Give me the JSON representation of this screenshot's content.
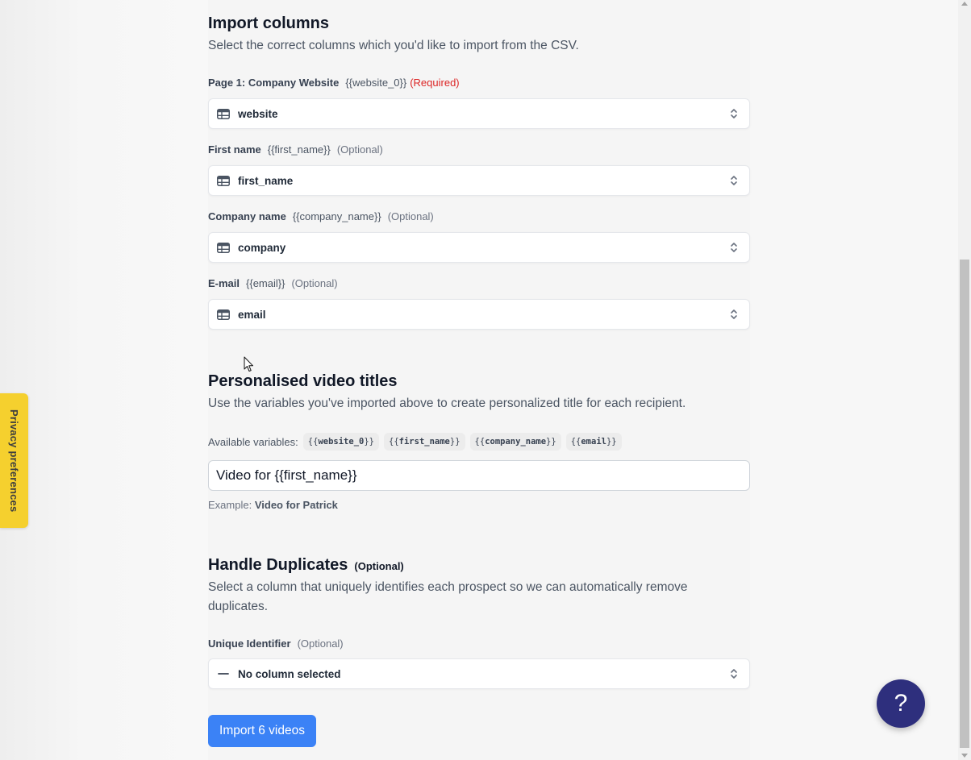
{
  "import_columns": {
    "title": "Import columns",
    "description": "Select the correct columns which you'd like to import from the CSV.",
    "fields": [
      {
        "name": "Page 1: Company Website",
        "variable": "{{website_0}}",
        "tag": "(Required)",
        "required": true,
        "value": "website"
      },
      {
        "name": "First name",
        "variable": "{{first_name}}",
        "tag": "(Optional)",
        "required": false,
        "value": "first_name"
      },
      {
        "name": "Company name",
        "variable": "{{company_name}}",
        "tag": "(Optional)",
        "required": false,
        "value": "company"
      },
      {
        "name": "E-mail",
        "variable": "{{email}}",
        "tag": "(Optional)",
        "required": false,
        "value": "email"
      }
    ]
  },
  "video_titles": {
    "title": "Personalised video titles",
    "description": "Use the variables you've imported above to create personalized title for each recipient.",
    "available_label": "Available variables:",
    "variables": [
      {
        "open": "{{",
        "name": "website_0",
        "close": "}}"
      },
      {
        "open": "{{",
        "name": "first_name",
        "close": "}}"
      },
      {
        "open": "{{",
        "name": "company_name",
        "close": "}}"
      },
      {
        "open": "{{",
        "name": "email",
        "close": "}}"
      }
    ],
    "input_value": "Video for {{first_name}}",
    "example_label": "Example:",
    "example_value": "Video for Patrick"
  },
  "duplicates": {
    "title": "Handle Duplicates",
    "title_tag": "(Optional)",
    "description_line1": "Select a column that uniquely identifies each prospect so we can automatically remove",
    "description_line2": "duplicates.",
    "field_name": "Unique Identifier",
    "field_tag": "(Optional)",
    "value": "No column selected"
  },
  "import_button": "Import 6 videos",
  "privacy_tab": "Privacy preferences",
  "help_button": "?",
  "colors": {
    "primary": "#3b82f6",
    "required": "#dc2626",
    "privacy": "#f5d02e",
    "help": "#2e2f7d"
  }
}
